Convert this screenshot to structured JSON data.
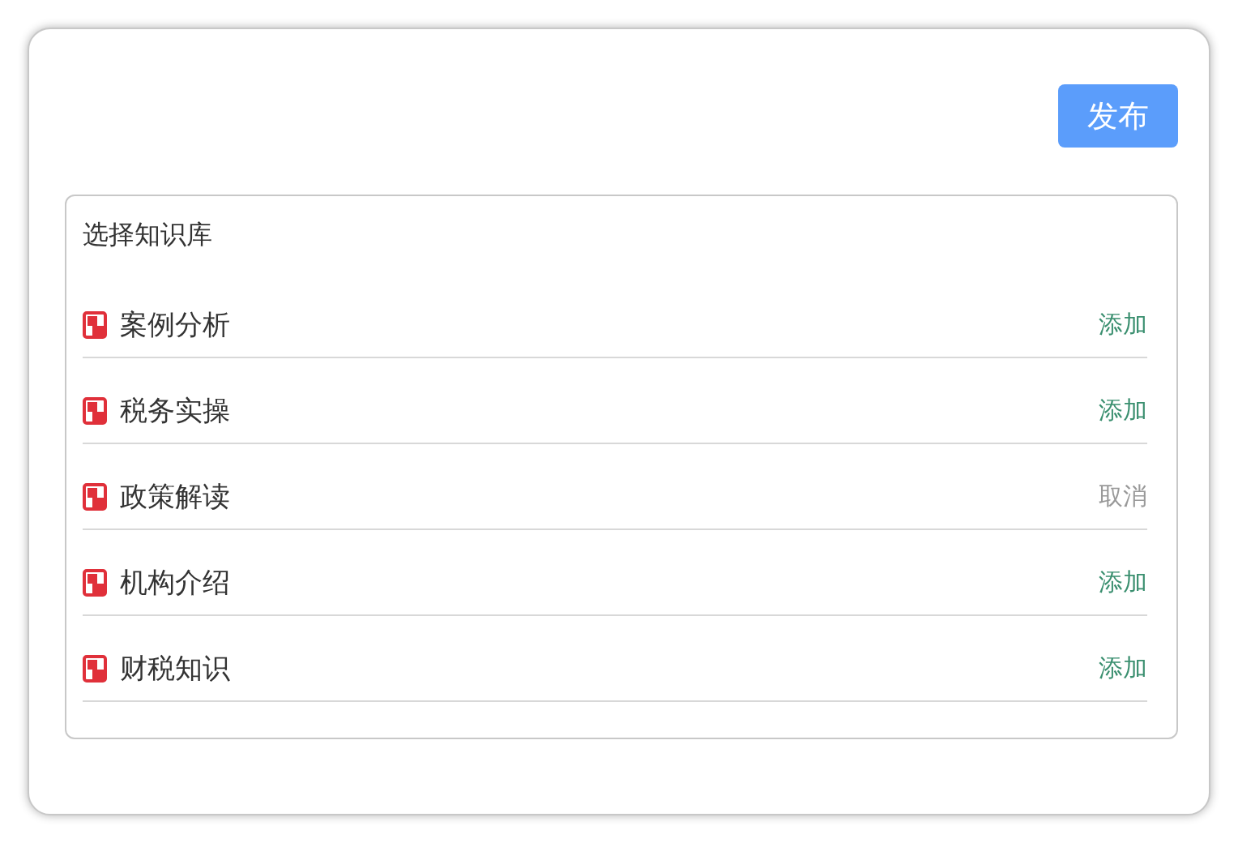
{
  "publish_button": "发布",
  "library": {
    "title": "选择知识库",
    "items": [
      {
        "name": "案例分析",
        "action": "添加",
        "added": false
      },
      {
        "name": "税务实操",
        "action": "添加",
        "added": false
      },
      {
        "name": "政策解读",
        "action": "取消",
        "added": true
      },
      {
        "name": "机构介绍",
        "action": "添加",
        "added": false
      },
      {
        "name": "财税知识",
        "action": "添加",
        "added": false
      }
    ]
  }
}
